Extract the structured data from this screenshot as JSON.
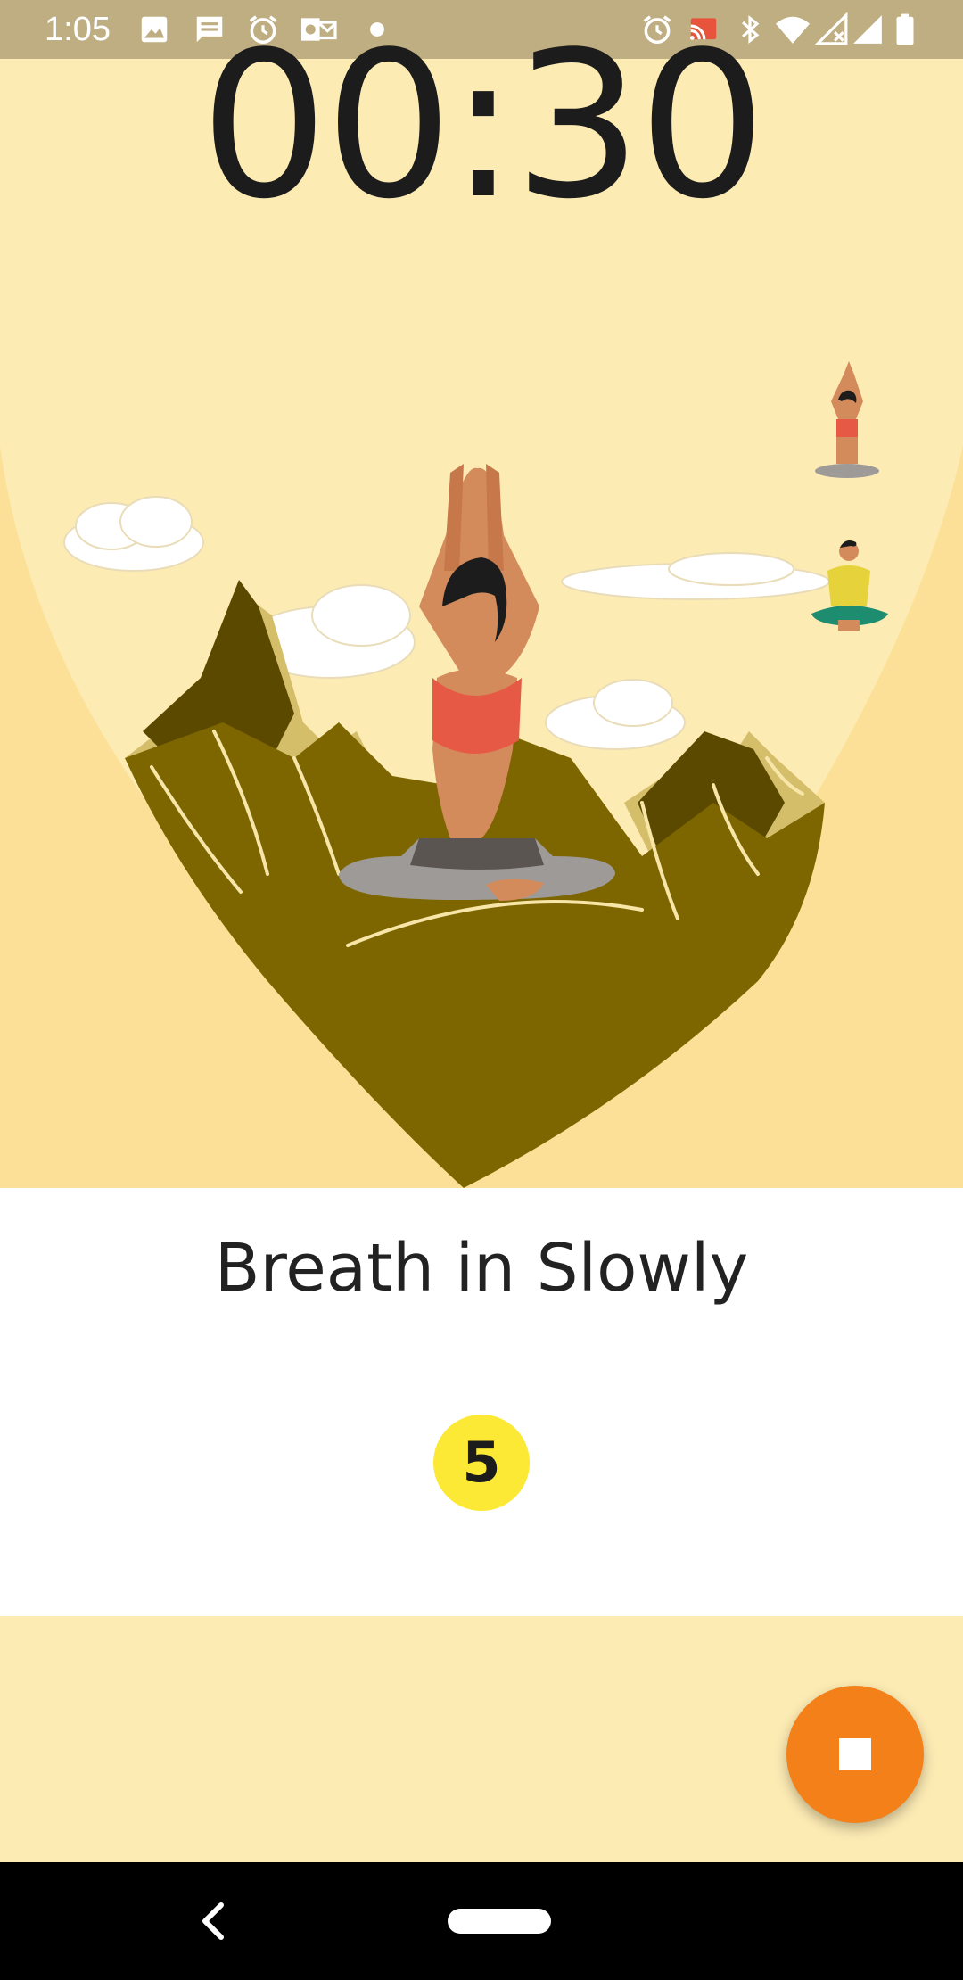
{
  "status_bar": {
    "time": "1:05",
    "left_icons": [
      "image-icon",
      "message-icon",
      "alarm-icon",
      "outlook-icon",
      "dot-icon"
    ],
    "right_icons": [
      "alarm-icon",
      "cast-icon",
      "bluetooth-icon",
      "wifi-icon",
      "signal-icon",
      "signal-icon",
      "battery-icon"
    ]
  },
  "timer": {
    "value": "00:30"
  },
  "instruction": {
    "text": "Breath in Slowly",
    "count": "5"
  },
  "controls": {
    "stop_icon": "stop-icon"
  },
  "colors": {
    "background": "#fdebb4",
    "status_bar": "#bfae81",
    "panel": "#ffffff",
    "count_badge": "#fbe935",
    "fab": "#f38019",
    "mountain": "#7d6600"
  },
  "nav_bar": {
    "icons": [
      "back-icon",
      "home-pill"
    ]
  }
}
